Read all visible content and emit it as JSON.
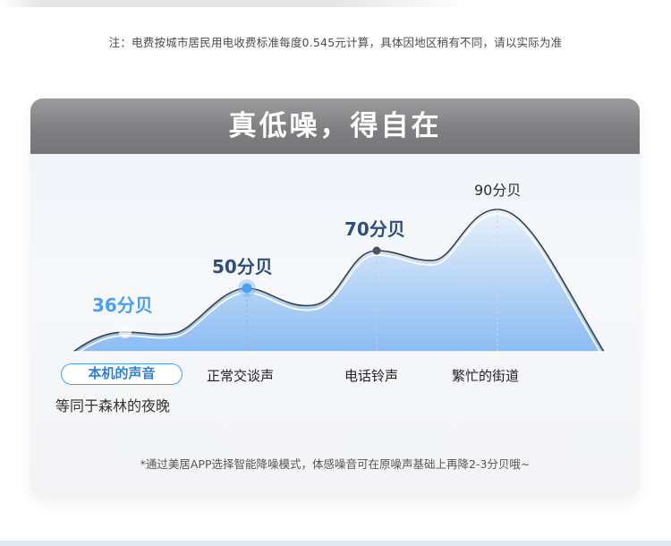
{
  "note": "注：电费按城市居民用电收费标准每度0.545元计算，具体因地区稍有不同，请以实际为准",
  "card": {
    "title": "真低噪，得自在"
  },
  "levels": [
    {
      "db": "36分贝",
      "category": "本机的声音",
      "sub": "等同于森林的夜晚",
      "value": 36
    },
    {
      "db": "50分贝",
      "category": "正常交谈声",
      "value": 50
    },
    {
      "db": "70分贝",
      "category": "电话铃声",
      "value": 70
    },
    {
      "db": "90分贝",
      "category": "繁忙的街道",
      "value": 90
    }
  ],
  "footnote": "*通过美居APP选择智能降噪模式，体感噪音可在原噪声基础上再降2-3分贝哦~",
  "colors": {
    "accent_blue": "#4aa0ee",
    "navy": "#2f4e78",
    "header_gray": "#8a8a8d"
  }
}
